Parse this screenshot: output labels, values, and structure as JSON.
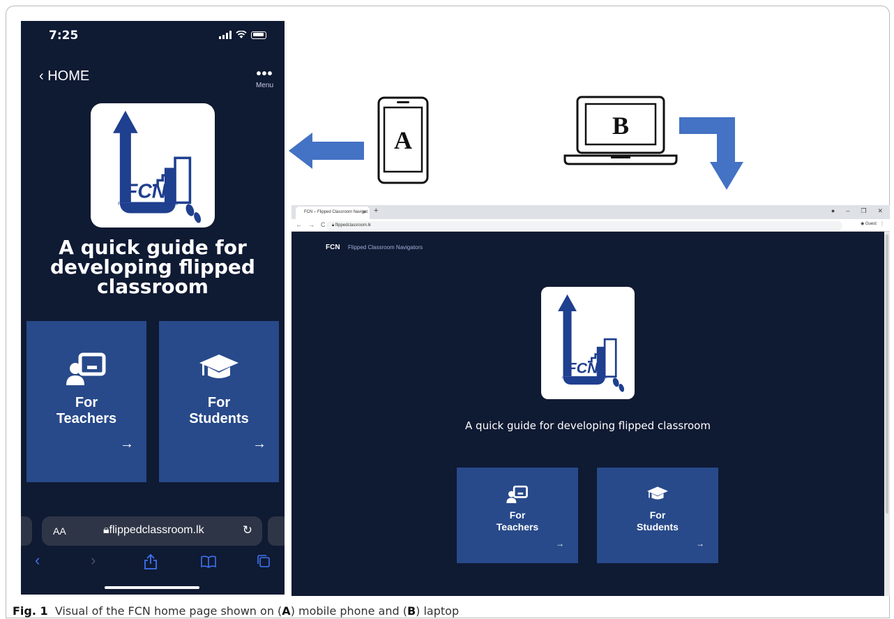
{
  "phone": {
    "status_time": "7:25",
    "back_label": "‹ HOME",
    "menu_icon": "ellipsis-icon",
    "menu_label": "Menu",
    "title": "A quick guide for developing flipped classroom",
    "tiles": [
      {
        "line1": "For",
        "line2": "Teachers",
        "icon": "teacher-icon"
      },
      {
        "line1": "For",
        "line2": "Students",
        "icon": "graduation-cap-icon"
      }
    ],
    "safari": {
      "text_size": "AA",
      "url": "flippedclassroom.lk"
    }
  },
  "logo": {
    "acronym": "FCN",
    "tagline": "Flipped Classroom Navigators"
  },
  "device_labels": {
    "mobile": "A",
    "laptop": "B"
  },
  "laptop": {
    "tab_title": "FCN – Flipped Classroom Navigat",
    "url": "flippedclassroom.lk",
    "profile": "Guest",
    "brand": "FCN",
    "brand_sub": "Flipped Classroom Navigators",
    "title": "A quick guide for developing flipped classroom",
    "tiles": [
      {
        "line1": "For",
        "line2": "Teachers",
        "icon": "teacher-icon"
      },
      {
        "line1": "For",
        "line2": "Students",
        "icon": "graduation-cap-icon"
      }
    ]
  },
  "caption": {
    "label": "Fig. 1",
    "text_1": "Visual of the FCN home page shown on (",
    "a": "A",
    "text_2": ") mobile phone and (",
    "b": "B",
    "text_3": ") laptop"
  },
  "colors": {
    "background": "#0f1a33",
    "tile": "#284a8a",
    "arrow": "#4472c4",
    "logo_blue": "#1f3f8f"
  }
}
